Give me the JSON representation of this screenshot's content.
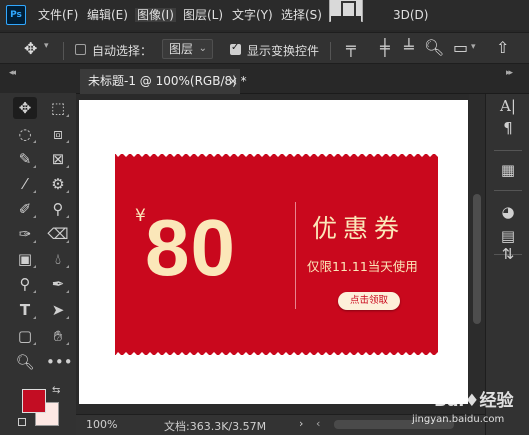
{
  "app": {
    "logo": "Ps"
  },
  "menu": [
    "文件(F)",
    "编辑(E)",
    "图像(I)",
    "图层(L)",
    "文字(Y)",
    "选择(S)",
    "3D(D)"
  ],
  "options": {
    "auto_select_label": "自动选择：",
    "auto_select_checked": false,
    "layer_dropdown": "图层",
    "show_transform_label": "显示变换控件",
    "show_transform_checked": true
  },
  "tab": {
    "title": "未标题-1 @ 100%(RGB/8) *",
    "close": "×"
  },
  "colors": {
    "foreground": "#c30d23",
    "background": "#fde8e4",
    "coupon": "#c9081d",
    "coupon_text": "#fbe7b9"
  },
  "coupon": {
    "currency": "¥",
    "amount": "80",
    "title": "优惠券",
    "subtitle": "仅限11.11当天使用",
    "button": "点击领取"
  },
  "status": {
    "zoom": "100%",
    "doc_label": "文档:",
    "doc_size": "363.3K/3.57M"
  },
  "watermark": {
    "brand": "Bai♦经验",
    "url": "jingyan.baidu.com"
  }
}
